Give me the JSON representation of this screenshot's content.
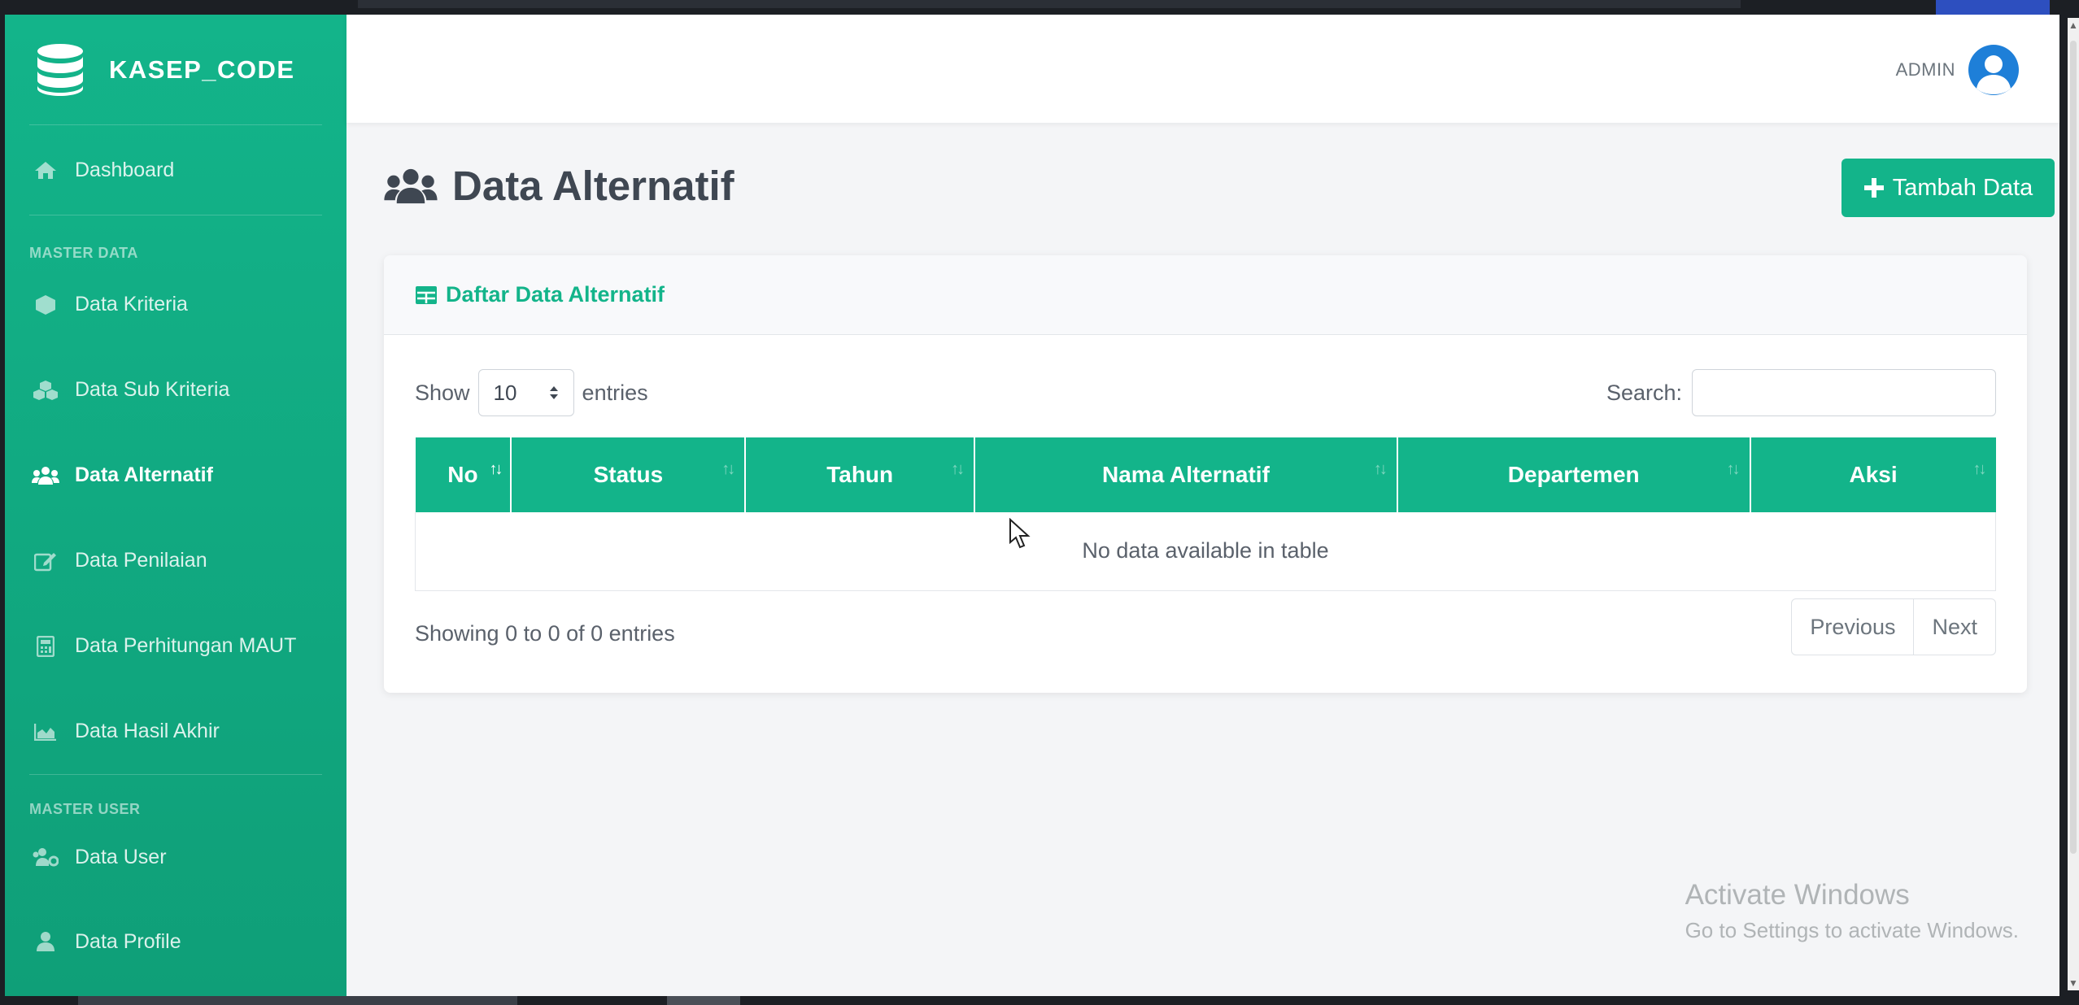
{
  "brand": {
    "name": "KASEP_CODE"
  },
  "sidebar": {
    "dashboard": "Dashboard",
    "heading_master_data": "MASTER DATA",
    "items_master_data": [
      {
        "label": "Data Kriteria",
        "icon": "cube-icon"
      },
      {
        "label": "Data Sub Kriteria",
        "icon": "cubes-icon"
      },
      {
        "label": "Data Alternatif",
        "icon": "users-icon",
        "active": true
      },
      {
        "label": "Data Penilaian",
        "icon": "edit-icon"
      },
      {
        "label": "Data Perhitungan MAUT",
        "icon": "calculator-icon"
      },
      {
        "label": "Data Hasil Akhir",
        "icon": "chart-area-icon"
      }
    ],
    "heading_master_user": "MASTER USER",
    "items_master_user": [
      {
        "label": "Data User",
        "icon": "users-cog-icon"
      },
      {
        "label": "Data Profile",
        "icon": "user-icon"
      }
    ]
  },
  "topbar": {
    "user_label": "ADMIN"
  },
  "page": {
    "title": "Data Alternatif",
    "add_button": "Tambah Data"
  },
  "card": {
    "title": "Daftar Data Alternatif",
    "show_label": "Show",
    "entries_label": "entries",
    "page_length": "10",
    "search_label": "Search:",
    "search_value": "",
    "columns": [
      "No",
      "Status",
      "Tahun",
      "Nama Alternatif",
      "Departemen",
      "Aksi"
    ],
    "empty_message": "No data available in table",
    "info": "Showing 0 to 0 of 0 entries",
    "prev": "Previous",
    "next": "Next"
  },
  "watermark": {
    "line1": "Activate Windows",
    "line2": "Go to Settings to activate Windows."
  },
  "colors": {
    "accent": "#13b48a",
    "avatar": "#1e7fd8"
  }
}
